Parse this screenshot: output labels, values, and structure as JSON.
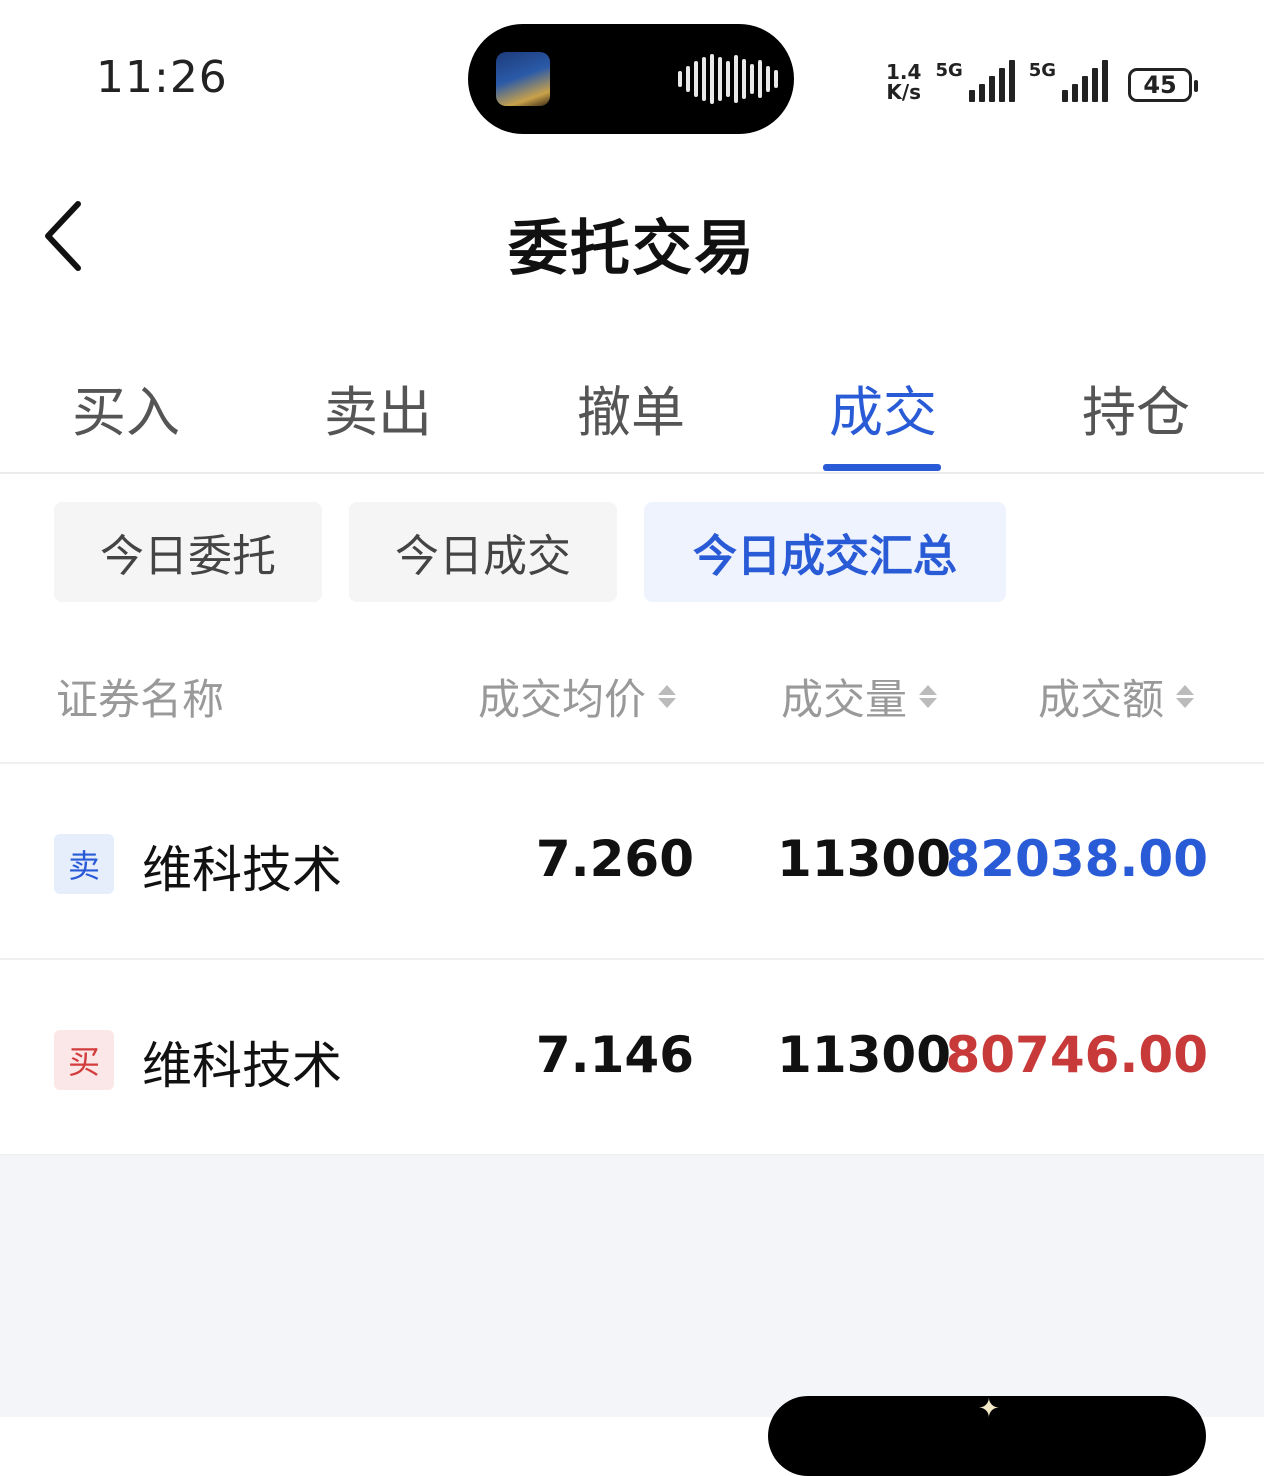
{
  "status_bar": {
    "time": "11:26",
    "speed_value": "1.4",
    "speed_unit": "K/s",
    "sim1_label": "5G",
    "sim2_label": "5G",
    "battery": "45"
  },
  "header": {
    "title": "委托交易"
  },
  "tabs": [
    {
      "label": "买入"
    },
    {
      "label": "卖出"
    },
    {
      "label": "撤单"
    },
    {
      "label": "成交"
    },
    {
      "label": "持仓"
    }
  ],
  "active_tab": "成交",
  "subtabs": [
    {
      "label": "今日委托"
    },
    {
      "label": "今日成交"
    },
    {
      "label": "今日成交汇总"
    }
  ],
  "active_subtab": "今日成交汇总",
  "table": {
    "columns": [
      "证券名称",
      "成交均价",
      "成交量",
      "成交额"
    ],
    "rows": [
      {
        "side": "卖",
        "name": "维科技术",
        "avg_price": "7.260",
        "volume": "11300",
        "amount": "82038.00"
      },
      {
        "side": "买",
        "name": "维科技术",
        "avg_price": "7.146",
        "volume": "11300",
        "amount": "80746.00"
      }
    ]
  },
  "colors": {
    "accent": "#2a5bd7",
    "sell": "#2a5bd7",
    "buy": "#c83a3a"
  }
}
